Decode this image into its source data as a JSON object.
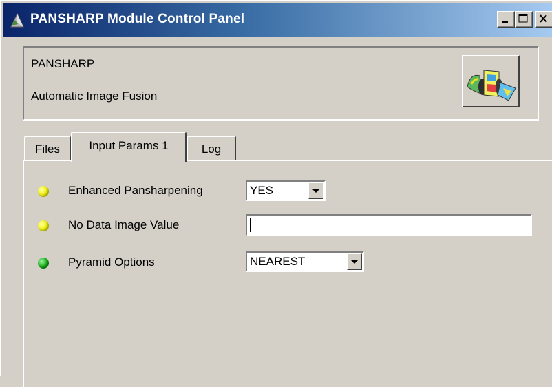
{
  "window": {
    "title": "PANSHARP Module Control Panel",
    "controls": [
      "minimize",
      "maximize",
      "close"
    ]
  },
  "header": {
    "module_name": "PANSHARP",
    "module_description": "Automatic Image Fusion",
    "icon": "image-fusion-icon"
  },
  "tabs": [
    {
      "label": "Files",
      "active": false
    },
    {
      "label": "Input Params 1",
      "active": true
    },
    {
      "label": "Log",
      "active": false
    }
  ],
  "params": [
    {
      "label": "Enhanced Pansharpening",
      "status": "yellow",
      "control": "select",
      "value": "YES"
    },
    {
      "label": "No Data Image Value",
      "status": "yellow",
      "control": "text",
      "value": ""
    },
    {
      "label": "Pyramid Options",
      "status": "green",
      "control": "select",
      "value": "NEAREST"
    }
  ],
  "colors": {
    "title_gradient_start": "#0a246a",
    "title_gradient_end": "#a6caf0",
    "status_yellow": "#f2f20a",
    "status_green": "#14b014",
    "panel_bg": "#d4d0c8"
  }
}
